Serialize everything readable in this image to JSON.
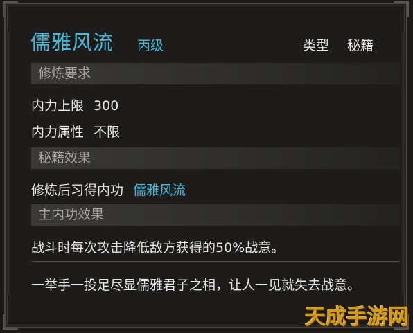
{
  "header": {
    "title": "儒雅风流",
    "grade": "丙级",
    "type_label": "类型",
    "type_value": "秘籍"
  },
  "requirements": {
    "section_label": "修炼要求",
    "rows": [
      {
        "label": "内力上限",
        "value": "300"
      },
      {
        "label": "内力属性",
        "value": "不限"
      }
    ]
  },
  "effects": {
    "section_label": "秘籍效果",
    "row_label": "修炼后习得内功",
    "row_value": "儒雅风流"
  },
  "main_effect": {
    "section_label": "主内功效果",
    "text": "战斗时每次攻击降低敌方获得的50%战意。"
  },
  "description": "一举手一投足尽显儒雅君子之相，让人一见就失去战意。",
  "watermark": "天成手游网",
  "colors": {
    "accent_blue": "#4bb8d8",
    "text": "#e6e6e6",
    "section_text": "#a9a6a1",
    "watermark": "#f0b020"
  }
}
